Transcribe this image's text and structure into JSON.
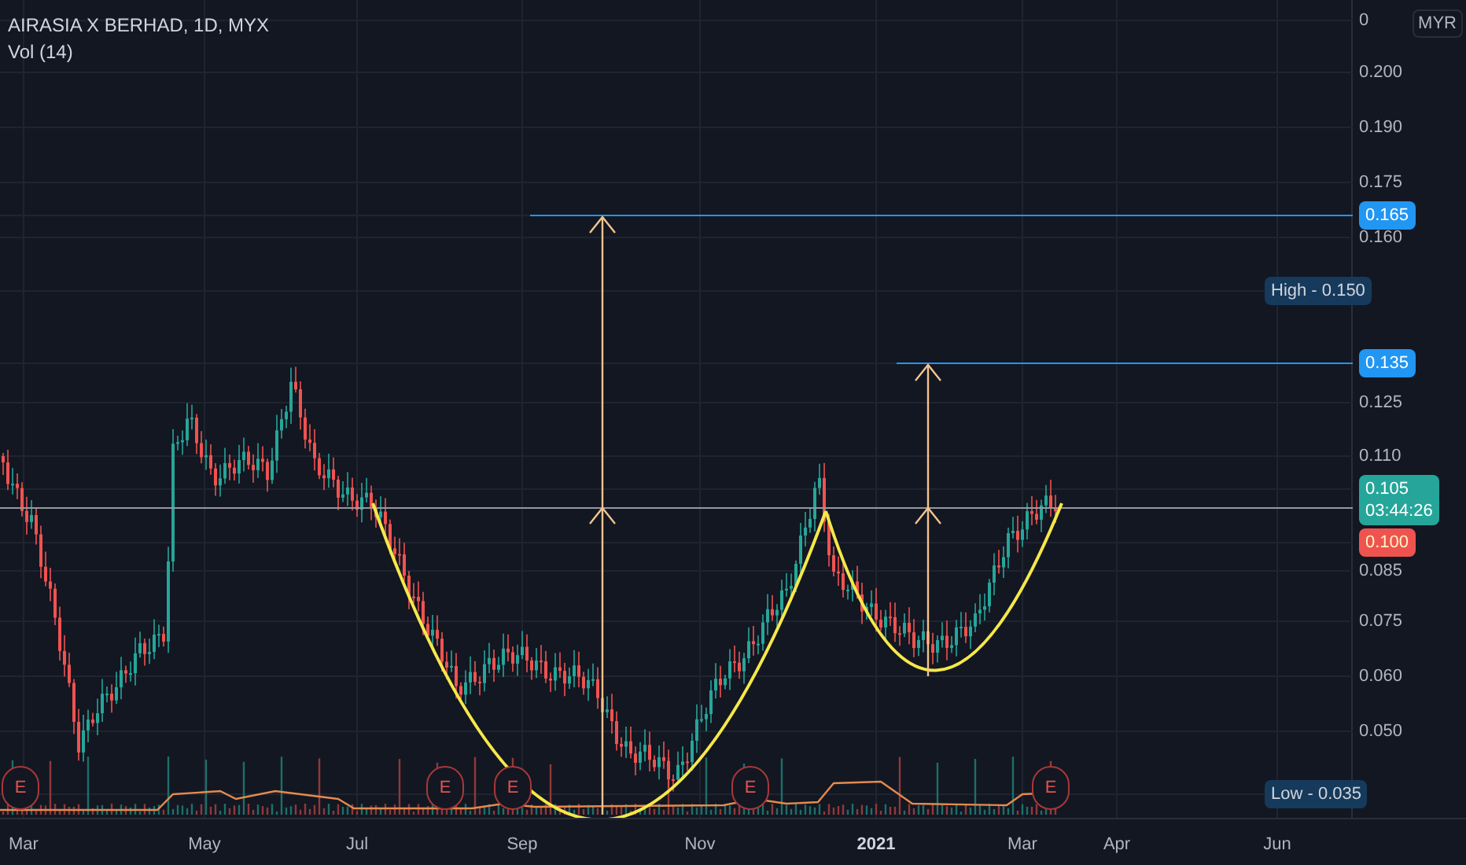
{
  "chart": {
    "title": "AIRASIA X BERHAD, 1D, MYX",
    "indicator": "Vol (14)",
    "currency": "MYR",
    "price_axis": [
      {
        "kind": "tick",
        "text": "0"
      },
      {
        "kind": "tick",
        "text": "0.200"
      },
      {
        "kind": "tick",
        "text": "0.190"
      },
      {
        "kind": "tick",
        "text": "0.175"
      },
      {
        "kind": "target",
        "text": "0.165"
      },
      {
        "kind": "tick",
        "text": "0.160"
      },
      {
        "kind": "extreme",
        "text": "High - 0.150"
      },
      {
        "kind": "target",
        "text": "0.135"
      },
      {
        "kind": "tick",
        "text": "0.125"
      },
      {
        "kind": "tick",
        "text": "0.110"
      },
      {
        "kind": "last",
        "text": "0.105",
        "time": "03:44:26"
      },
      {
        "kind": "previous",
        "text": "0.100"
      },
      {
        "kind": "tick",
        "text": "0.085"
      },
      {
        "kind": "tick",
        "text": "0.075"
      },
      {
        "kind": "tick",
        "text": "0.060"
      },
      {
        "kind": "tick",
        "text": "0.050"
      },
      {
        "kind": "extreme",
        "text": "Low - 0.035"
      }
    ],
    "time_axis": [
      {
        "text": "Mar",
        "kind": "month"
      },
      {
        "text": "May",
        "kind": "month"
      },
      {
        "text": "Jul",
        "kind": "month"
      },
      {
        "text": "Sep",
        "kind": "month"
      },
      {
        "text": "Nov",
        "kind": "month"
      },
      {
        "text": "2021",
        "kind": "year"
      },
      {
        "text": "Mar",
        "kind": "month"
      },
      {
        "text": "Apr",
        "kind": "month"
      },
      {
        "text": "Jun",
        "kind": "month"
      }
    ],
    "earnings_markers": [
      "E",
      "E",
      "E",
      "E",
      "E"
    ]
  }
}
